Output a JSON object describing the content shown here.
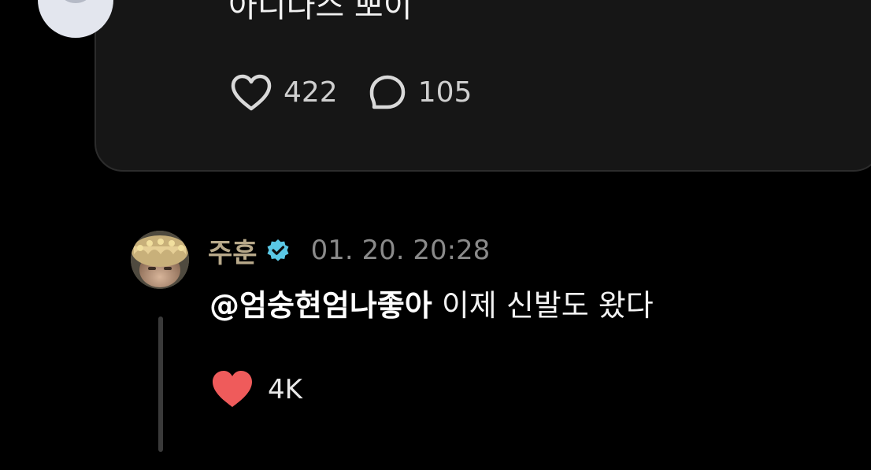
{
  "post": {
    "text": "아디다스 뽀이",
    "like_count": "422",
    "reply_count": "105",
    "avatar_icon": "default-avatar-icon"
  },
  "reply": {
    "username": "주훈",
    "verified_icon": "verified-badge-icon",
    "timestamp": "01. 20. 20:28",
    "mention": "@엄숭현엄나좋아",
    "text": " 이제 신발도 왔다",
    "like_count": "4K",
    "liked": true
  },
  "colors": {
    "background": "#000000",
    "card": "#161616",
    "username": "#b8a98a",
    "verified": "#5ac8e6",
    "liked_heart": "#ef5b5b"
  }
}
